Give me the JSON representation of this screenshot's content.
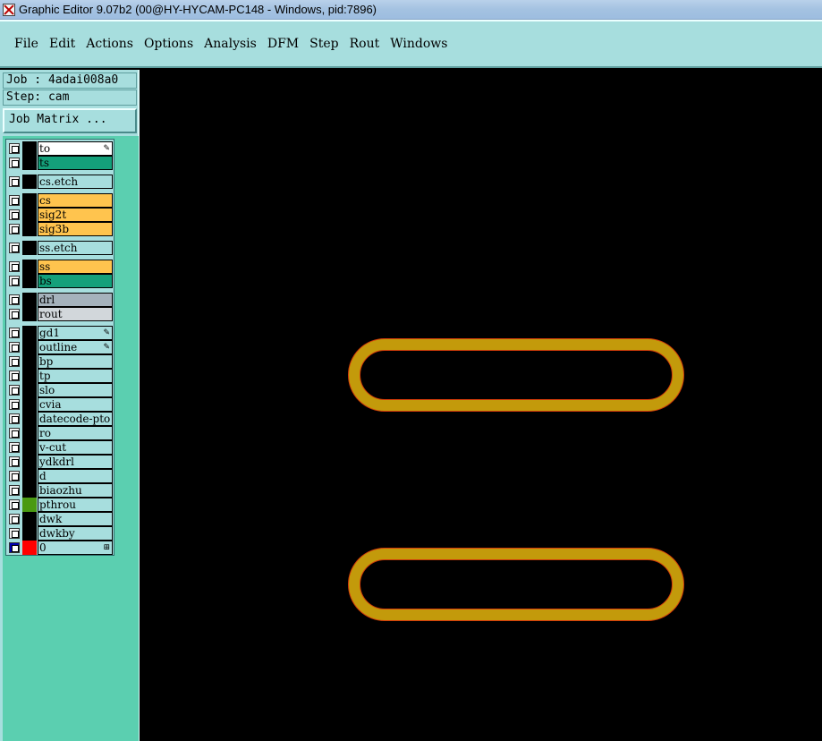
{
  "window": {
    "title": "Graphic Editor 9.07b2 (00@HY-HYCAM-PC148 - Windows, pid:7896)"
  },
  "menu": {
    "items": [
      "File",
      "Edit",
      "Actions",
      "Options",
      "Analysis",
      "DFM",
      "Step",
      "Rout",
      "Windows"
    ]
  },
  "job": {
    "job_label": "Job : 4adai008a0",
    "step_label": "Step: cam",
    "matrix_button": "Job Matrix ..."
  },
  "layers": [
    {
      "name": "to",
      "color": "#ffffff",
      "swatch": "#000000",
      "mark": "pen-icon"
    },
    {
      "name": "ts",
      "color": "#14a07a",
      "swatch": "#000000"
    },
    {
      "name": "cs.etch",
      "color": "#a7dede",
      "swatch": "#000000"
    },
    {
      "name": "cs",
      "color": "#ffc44e",
      "swatch": "#000000"
    },
    {
      "name": "sig2t",
      "color": "#ffc44e",
      "swatch": "#000000"
    },
    {
      "name": "sig3b",
      "color": "#ffc44e",
      "swatch": "#000000"
    },
    {
      "name": "ss.etch",
      "color": "#a7dede",
      "swatch": "#000000"
    },
    {
      "name": "ss",
      "color": "#ffc44e",
      "swatch": "#000000"
    },
    {
      "name": "bs",
      "color": "#14a07a",
      "swatch": "#000000"
    },
    {
      "name": "drl",
      "color": "#a5b2bc",
      "swatch": "#000000"
    },
    {
      "name": "rout",
      "color": "#d2d7db",
      "swatch": "#000000"
    },
    {
      "name": "gd1",
      "color": "#a7dede",
      "swatch": "#000000",
      "mark": "pen-icon"
    },
    {
      "name": "outline",
      "color": "#a7dede",
      "swatch": "#000000",
      "mark": "pen-icon"
    },
    {
      "name": "bp",
      "color": "#a7dede",
      "swatch": "#000000"
    },
    {
      "name": "tp",
      "color": "#a7dede",
      "swatch": "#000000"
    },
    {
      "name": "slo",
      "color": "#a7dede",
      "swatch": "#000000"
    },
    {
      "name": "cvia",
      "color": "#a7dede",
      "swatch": "#000000"
    },
    {
      "name": "datecode-pto",
      "color": "#a7dede",
      "swatch": "#000000"
    },
    {
      "name": "ro",
      "color": "#a7dede",
      "swatch": "#000000"
    },
    {
      "name": "v-cut",
      "color": "#a7dede",
      "swatch": "#000000"
    },
    {
      "name": "ydkdrl",
      "color": "#a7dede",
      "swatch": "#000000"
    },
    {
      "name": "d",
      "color": "#a7dede",
      "swatch": "#000000"
    },
    {
      "name": "biaozhu",
      "color": "#a7dede",
      "swatch": "#000000"
    },
    {
      "name": "pthrou",
      "color": "#a7dede",
      "swatch": "#4a9a12"
    },
    {
      "name": "dwk",
      "color": "#a7dede",
      "swatch": "#000000"
    },
    {
      "name": "dwkby",
      "color": "#a7dede",
      "swatch": "#000000"
    },
    {
      "name": "0",
      "color": "#a7dede",
      "swatch": "#ff0000",
      "check_color": "#0000b0",
      "mark": "grid-icon"
    }
  ],
  "canvas": {
    "shape_fill": "#c39a0b",
    "shape_edge": "#d23c0a"
  }
}
